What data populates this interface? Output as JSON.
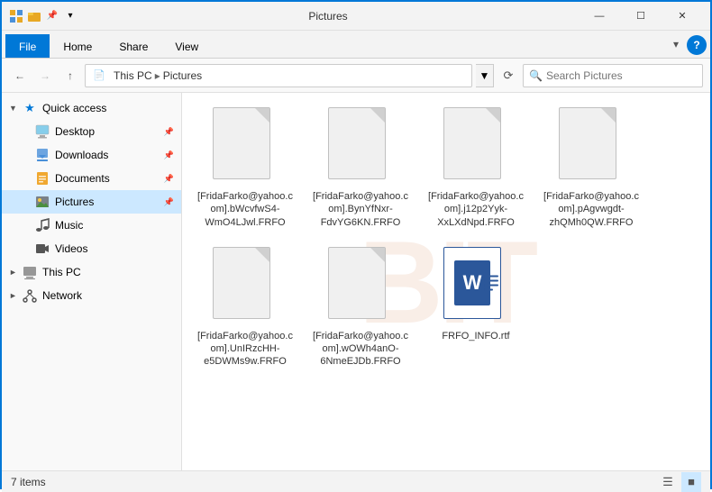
{
  "titleBar": {
    "title": "Pictures",
    "minimizeLabel": "—",
    "maximizeLabel": "☐",
    "closeLabel": "✕"
  },
  "ribbon": {
    "tabs": [
      "File",
      "Home",
      "Share",
      "View"
    ],
    "activeTab": "File"
  },
  "addressBar": {
    "backDisabled": false,
    "forwardDisabled": true,
    "upDisabled": false,
    "path": [
      "This PC",
      "Pictures"
    ],
    "searchPlaceholder": "Search Pictures"
  },
  "sidebar": {
    "quickAccessLabel": "Quick access",
    "items": [
      {
        "id": "desktop",
        "label": "Desktop",
        "indent": 2,
        "pinned": true
      },
      {
        "id": "downloads",
        "label": "Downloads",
        "indent": 2,
        "pinned": true
      },
      {
        "id": "documents",
        "label": "Documents",
        "indent": 2,
        "pinned": true
      },
      {
        "id": "pictures",
        "label": "Pictures",
        "indent": 2,
        "pinned": true,
        "selected": true
      },
      {
        "id": "music",
        "label": "Music",
        "indent": 2
      },
      {
        "id": "videos",
        "label": "Videos",
        "indent": 2
      }
    ],
    "thisPC": {
      "label": "This PC",
      "expanded": false
    },
    "network": {
      "label": "Network",
      "expanded": false
    }
  },
  "files": [
    {
      "id": "file1",
      "name": "[FridaFarko@yahoo.com].bWcvfwS4-WmO4LJwl.FRFO",
      "type": "generic"
    },
    {
      "id": "file2",
      "name": "[FridaFarko@yahoo.com].BynYfNxr-FdvYG6KN.FRFO",
      "type": "generic"
    },
    {
      "id": "file3",
      "name": "[FridaFarko@yahoo.com].j12p2Yyk-XxLXdNpd.FRFO",
      "type": "generic"
    },
    {
      "id": "file4",
      "name": "[FridaFarko@yahoo.com].pAgvwgdt-zhQMh0QW.FRFO",
      "type": "generic"
    },
    {
      "id": "file5",
      "name": "[FridaFarko@yahoo.com].UnIRzcHH-e5DWMs9w.FRFO",
      "type": "generic"
    },
    {
      "id": "file6",
      "name": "[FridaFarko@yahoo.com].wOWh4anO-6NmeEJDb.FRFO",
      "type": "generic"
    },
    {
      "id": "file7",
      "name": "FRFO_INFO.rtf",
      "type": "word"
    }
  ],
  "statusBar": {
    "itemCount": "7 items"
  }
}
